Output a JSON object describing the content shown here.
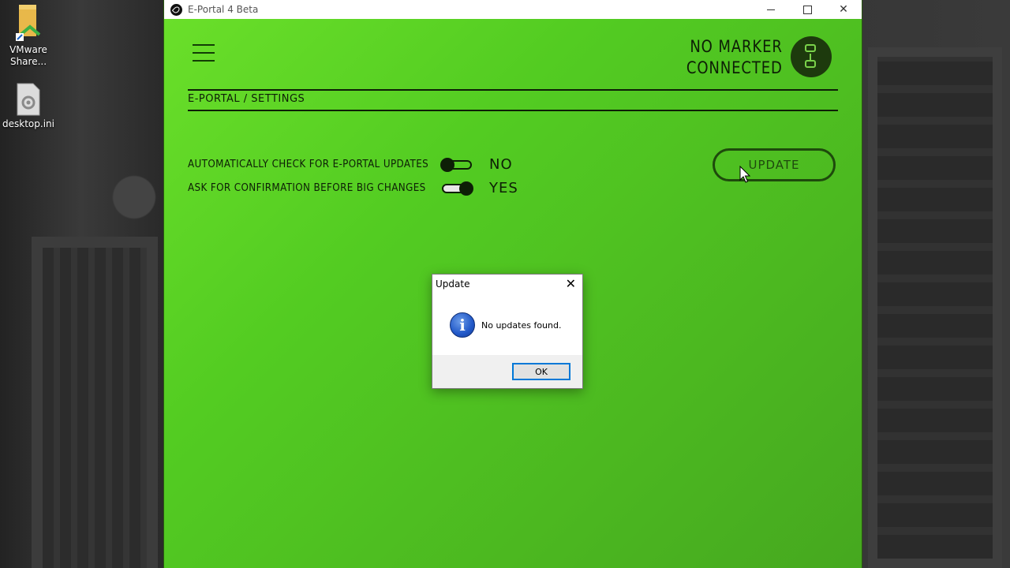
{
  "desktop": {
    "icons": [
      {
        "label": "VMware\nShare...",
        "icon": "shared-folder-icon"
      },
      {
        "label": "desktop.ini",
        "icon": "settings-file-icon"
      }
    ]
  },
  "window": {
    "title": "E-Portal 4 Beta",
    "controls": {
      "minimize": "minimize",
      "maximize": "maximize",
      "close": "✕"
    }
  },
  "header": {
    "status_line1": "NO MARKER",
    "status_line2": "CONNECTED"
  },
  "breadcrumb": "E-PORTAL / SETTINGS",
  "settings": [
    {
      "label": "AUTOMATICALLY CHECK FOR E-PORTAL UPDATES",
      "value": "NO",
      "on": false
    },
    {
      "label": "ASK FOR CONFIRMATION BEFORE BIG CHANGES",
      "value": "YES",
      "on": true
    }
  ],
  "update_button": "UPDATE",
  "dialog": {
    "title": "Update",
    "close": "✕",
    "message": "No updates found.",
    "ok": "OK",
    "icon": "info-icon"
  },
  "colors": {
    "app_green": "#53cc22",
    "text_dark": "#0d1f06",
    "accent_blue": "#0078d7"
  }
}
